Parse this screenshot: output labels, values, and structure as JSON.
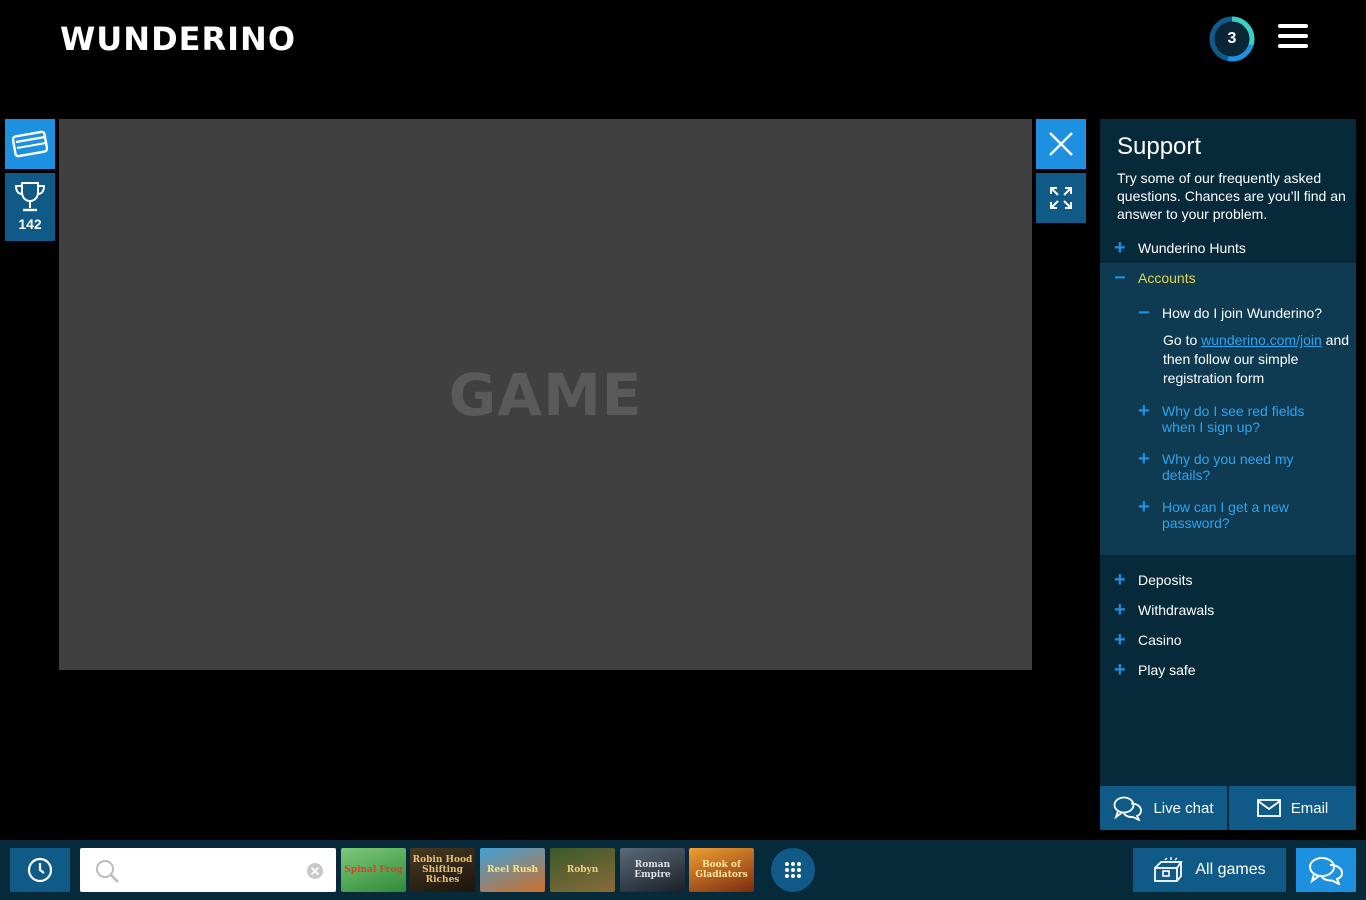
{
  "header": {
    "logo_text": "WUNDERINO",
    "level": "3",
    "menu_icon": "hamburger-icon"
  },
  "left_rail": {
    "card_icon": "card-icon",
    "trophy_icon": "trophy-icon",
    "trophy_count": "142"
  },
  "game": {
    "label": "GAME",
    "close_icon": "close-icon",
    "fullscreen_icon": "fullscreen-icon"
  },
  "support": {
    "title": "Support",
    "intro": "Try some of our frequently asked questions. Chances are you’ll find an answer to your problem.",
    "categories": [
      {
        "label": "Wunderino Hunts",
        "sign": "+"
      },
      {
        "label": "Accounts",
        "sign": "−"
      },
      {
        "label": "Deposits",
        "sign": "+"
      },
      {
        "label": "Withdrawals",
        "sign": "+"
      },
      {
        "label": "Casino",
        "sign": "+"
      },
      {
        "label": "Play safe",
        "sign": "+"
      }
    ],
    "account_questions": [
      {
        "label": "How do I join Wunderino?",
        "sign": "−"
      },
      {
        "label": "Why do I see red fields when I sign up?",
        "sign": "+"
      },
      {
        "label": "Why do you need my details?",
        "sign": "+"
      },
      {
        "label": "How can I get a new password?",
        "sign": "+"
      }
    ],
    "answer": {
      "prefix": "Go to ",
      "link": "wunderino.com/join",
      "suffix": " and then follow our simple registration form"
    },
    "live_chat_label": "Live chat",
    "email_label": "Email"
  },
  "bottom_bar": {
    "search_placeholder": "",
    "search_value": "",
    "thumbnails": [
      "Spinal Frog",
      "Robin Hood Shifting Riches",
      "Reel Rush",
      "Robyn",
      "Roman Empire",
      "Book of Gladiators"
    ],
    "all_games_label": "All games"
  },
  "colors": {
    "accent": "#1e90e0",
    "panel": "#072a3a",
    "button": "#0f5a87",
    "highlight": "#e3d64a"
  }
}
